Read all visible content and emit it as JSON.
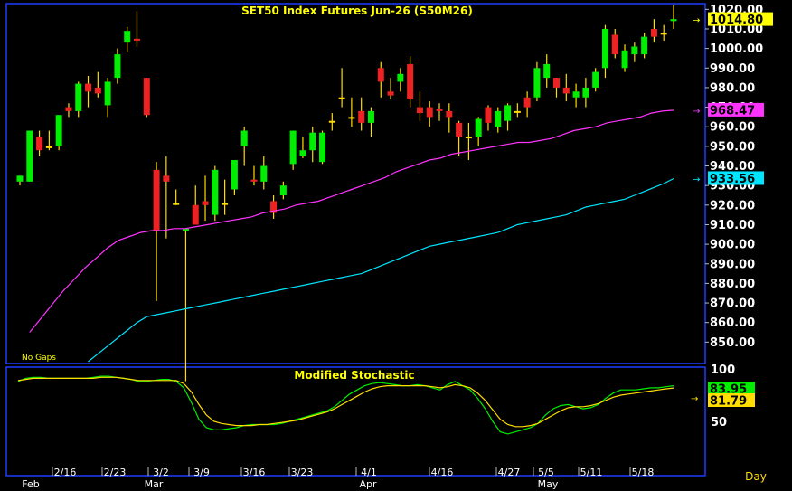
{
  "chart_data": [
    {
      "type": "candlestick",
      "title": "SET50  Index  Futures  Jun-26  (S50M26)",
      "note": "No  Gaps",
      "ylim": [
        840,
        1022
      ],
      "y_ticks": [
        850,
        860,
        870,
        880,
        890,
        900,
        910,
        920,
        930,
        940,
        950,
        960,
        970,
        980,
        990,
        1000,
        1010,
        1020
      ],
      "y_tick_labels": [
        "850.00",
        "860.00",
        "870.00",
        "880.00",
        "890.00",
        "900.00",
        "910.00",
        "920.00",
        "930.00",
        "940.00",
        "950.00",
        "960.00",
        "970.00",
        "980.00",
        "990.00",
        "1000.00",
        "1010.00",
        "1020.00"
      ],
      "last_price_label": "1014.80",
      "ma_labels": [
        {
          "value": 968.47,
          "label": "968.47",
          "color": "#ff33ff"
        },
        {
          "value": 933.56,
          "label": "933.56",
          "color": "#00e5ff"
        }
      ],
      "colors": {
        "up": "#00ee00",
        "down": "#ee2222",
        "doji": "#ffdd00",
        "ma_fast": "#ff33ff",
        "ma_slow": "#00e5ff",
        "price_tag": "#ffff00"
      },
      "candles": [
        {
          "o": 932,
          "h": 935,
          "l": 930,
          "c": 935
        },
        {
          "o": 932,
          "h": 958,
          "l": 932,
          "c": 958
        },
        {
          "o": 955,
          "h": 958,
          "l": 945,
          "c": 948
        },
        {
          "o": 950,
          "h": 958,
          "l": 948,
          "c": 950
        },
        {
          "o": 950,
          "h": 966,
          "l": 948,
          "c": 966
        },
        {
          "o": 970,
          "h": 972,
          "l": 965,
          "c": 968
        },
        {
          "o": 968,
          "h": 983,
          "l": 965,
          "c": 982
        },
        {
          "o": 982,
          "h": 986,
          "l": 970,
          "c": 978
        },
        {
          "o": 980,
          "h": 988,
          "l": 975,
          "c": 977
        },
        {
          "o": 971,
          "h": 985,
          "l": 965,
          "c": 983
        },
        {
          "o": 985,
          "h": 1000,
          "l": 982,
          "c": 997
        },
        {
          "o": 1003,
          "h": 1011,
          "l": 998,
          "c": 1009
        },
        {
          "o": 1005,
          "h": 1019,
          "l": 1001,
          "c": 1004
        },
        {
          "o": 985,
          "h": 985,
          "l": 965,
          "c": 966
        },
        {
          "o": 938,
          "h": 942,
          "l": 871,
          "c": 907
        },
        {
          "o": 935,
          "h": 945,
          "l": 903,
          "c": 932
        },
        {
          "o": 921,
          "h": 928,
          "l": 920,
          "c": 921
        },
        {
          "o": 907,
          "h": 908,
          "l": 830,
          "c": 908
        },
        {
          "o": 920,
          "h": 930,
          "l": 910,
          "c": 910
        },
        {
          "o": 922,
          "h": 935,
          "l": 912,
          "c": 920
        },
        {
          "o": 915,
          "h": 940,
          "l": 912,
          "c": 938
        },
        {
          "o": 921,
          "h": 933,
          "l": 915,
          "c": 921
        },
        {
          "o": 928,
          "h": 943,
          "l": 925,
          "c": 943
        },
        {
          "o": 950,
          "h": 960,
          "l": 940,
          "c": 958
        },
        {
          "o": 933,
          "h": 940,
          "l": 930,
          "c": 932
        },
        {
          "o": 932,
          "h": 945,
          "l": 928,
          "c": 940
        },
        {
          "o": 922,
          "h": 925,
          "l": 913,
          "c": 916
        },
        {
          "o": 925,
          "h": 932,
          "l": 923,
          "c": 930
        },
        {
          "o": 941,
          "h": 958,
          "l": 938,
          "c": 958
        },
        {
          "o": 945,
          "h": 955,
          "l": 944,
          "c": 948
        },
        {
          "o": 948,
          "h": 960,
          "l": 942,
          "c": 957
        },
        {
          "o": 942,
          "h": 958,
          "l": 941,
          "c": 957
        },
        {
          "o": 963,
          "h": 967,
          "l": 958,
          "c": 963
        },
        {
          "o": 975,
          "h": 990,
          "l": 970,
          "c": 975
        },
        {
          "o": 965,
          "h": 975,
          "l": 960,
          "c": 965
        },
        {
          "o": 968,
          "h": 975,
          "l": 958,
          "c": 962
        },
        {
          "o": 962,
          "h": 970,
          "l": 955,
          "c": 968
        },
        {
          "o": 990,
          "h": 993,
          "l": 975,
          "c": 983
        },
        {
          "o": 978,
          "h": 985,
          "l": 974,
          "c": 976
        },
        {
          "o": 983,
          "h": 990,
          "l": 978,
          "c": 987
        },
        {
          "o": 992,
          "h": 996,
          "l": 970,
          "c": 974
        },
        {
          "o": 970,
          "h": 978,
          "l": 963,
          "c": 967
        },
        {
          "o": 970,
          "h": 973,
          "l": 960,
          "c": 965
        },
        {
          "o": 969,
          "h": 972,
          "l": 963,
          "c": 968
        },
        {
          "o": 968,
          "h": 972,
          "l": 957,
          "c": 965
        },
        {
          "o": 962,
          "h": 963,
          "l": 945,
          "c": 955
        },
        {
          "o": 955,
          "h": 962,
          "l": 943,
          "c": 955
        },
        {
          "o": 955,
          "h": 965,
          "l": 950,
          "c": 964
        },
        {
          "o": 970,
          "h": 971,
          "l": 958,
          "c": 962
        },
        {
          "o": 960,
          "h": 970,
          "l": 957,
          "c": 968
        },
        {
          "o": 963,
          "h": 972,
          "l": 958,
          "c": 971
        },
        {
          "o": 968,
          "h": 972,
          "l": 965,
          "c": 968
        },
        {
          "o": 975,
          "h": 978,
          "l": 965,
          "c": 970
        },
        {
          "o": 975,
          "h": 993,
          "l": 973,
          "c": 990
        },
        {
          "o": 985,
          "h": 997,
          "l": 980,
          "c": 992
        },
        {
          "o": 985,
          "h": 985,
          "l": 975,
          "c": 980
        },
        {
          "o": 980,
          "h": 987,
          "l": 973,
          "c": 977
        },
        {
          "o": 975,
          "h": 982,
          "l": 970,
          "c": 978
        },
        {
          "o": 975,
          "h": 985,
          "l": 970,
          "c": 980
        },
        {
          "o": 980,
          "h": 990,
          "l": 978,
          "c": 988
        },
        {
          "o": 990,
          "h": 1012,
          "l": 985,
          "c": 1010
        },
        {
          "o": 1007,
          "h": 1010,
          "l": 995,
          "c": 997
        },
        {
          "o": 990,
          "h": 1002,
          "l": 988,
          "c": 999
        },
        {
          "o": 997,
          "h": 1003,
          "l": 993,
          "c": 1001
        },
        {
          "o": 997,
          "h": 1008,
          "l": 995,
          "c": 1006
        },
        {
          "o": 1010,
          "h": 1015,
          "l": 1003,
          "c": 1006
        },
        {
          "o": 1008,
          "h": 1012,
          "l": 1004,
          "c": 1008
        },
        {
          "o": 1014,
          "h": 1022,
          "l": 1010,
          "c": 1015
        }
      ],
      "ma_fast": [
        855,
        862,
        869,
        876,
        882,
        888,
        893,
        898,
        902,
        904,
        906,
        907,
        907,
        908,
        908,
        909,
        910,
        911,
        912,
        913,
        914,
        916,
        917,
        918,
        920,
        921,
        922,
        924,
        926,
        928,
        930,
        932,
        934,
        937,
        939,
        941,
        943,
        944,
        946,
        947,
        948,
        949,
        950,
        951,
        952,
        952,
        953,
        954,
        956,
        958,
        959,
        960,
        962,
        963,
        964,
        965,
        967,
        968,
        968.47
      ],
      "ma_slow": [
        840,
        844,
        848,
        852,
        856,
        860,
        863,
        864,
        865,
        866,
        867,
        868,
        869,
        870,
        871,
        872,
        873,
        874,
        875,
        876,
        877,
        878,
        879,
        880,
        881,
        882,
        883,
        884,
        885,
        887,
        889,
        891,
        893,
        895,
        897,
        899,
        900,
        901,
        902,
        903,
        904,
        905,
        906,
        908,
        910,
        911,
        912,
        913,
        914,
        915,
        917,
        919,
        920,
        921,
        922,
        923,
        925,
        927,
        929,
        931,
        933.56
      ],
      "ma_fast_start": 1,
      "ma_slow_start": 7
    },
    {
      "type": "line",
      "title": "Modified  Stochastic",
      "ylim": [
        0,
        100
      ],
      "y_ticks": [
        50,
        100
      ],
      "y_tick_labels": [
        "50",
        "100"
      ],
      "series": [
        {
          "name": "",
          "label": "83.95",
          "color": "#00ee00",
          "values": [
            88,
            91,
            92,
            92,
            91,
            91,
            91,
            91,
            91,
            91,
            92,
            93,
            93,
            92,
            91,
            90,
            88,
            88,
            89,
            90,
            90,
            88,
            82,
            68,
            52,
            44,
            42,
            42,
            43,
            44,
            46,
            47,
            47,
            47,
            47,
            48,
            50,
            52,
            54,
            56,
            58,
            60,
            64,
            70,
            76,
            80,
            84,
            86,
            87,
            86,
            85,
            84,
            84,
            85,
            84,
            82,
            80,
            85,
            88,
            84,
            80,
            72,
            62,
            50,
            40,
            38,
            40,
            42,
            44,
            48,
            56,
            62,
            65,
            66,
            64,
            62,
            63,
            66,
            72,
            77,
            80,
            80,
            80,
            81,
            82,
            82,
            83,
            83.95
          ]
        },
        {
          "name": "",
          "label": "81.79",
          "color": "#ffdd00",
          "values": [
            89,
            90,
            91,
            91,
            91,
            91,
            91,
            91,
            91,
            91,
            91,
            92,
            92,
            92,
            91,
            90,
            89,
            89,
            89,
            89,
            89,
            89,
            86,
            78,
            66,
            56,
            50,
            48,
            47,
            46,
            46,
            46,
            47,
            47,
            48,
            49,
            50,
            51,
            53,
            55,
            57,
            59,
            62,
            66,
            70,
            74,
            78,
            81,
            83,
            84,
            84,
            84,
            84,
            84,
            84,
            83,
            82,
            83,
            85,
            84,
            82,
            77,
            70,
            61,
            52,
            47,
            45,
            45,
            46,
            48,
            52,
            56,
            60,
            63,
            64,
            64,
            65,
            67,
            70,
            73,
            75,
            76,
            77,
            78,
            79,
            80,
            81,
            81.79
          ]
        }
      ]
    }
  ],
  "x_axis": {
    "labels": [
      "2/16",
      "2/23",
      "3/2",
      "3/9",
      "3/16",
      "3/23",
      "4/1",
      "4/16",
      "4/27",
      "5/5",
      "5/11",
      "5/18"
    ],
    "months": [
      "Feb",
      "Mar",
      "Apr",
      "May"
    ],
    "unit_label": "Day"
  }
}
